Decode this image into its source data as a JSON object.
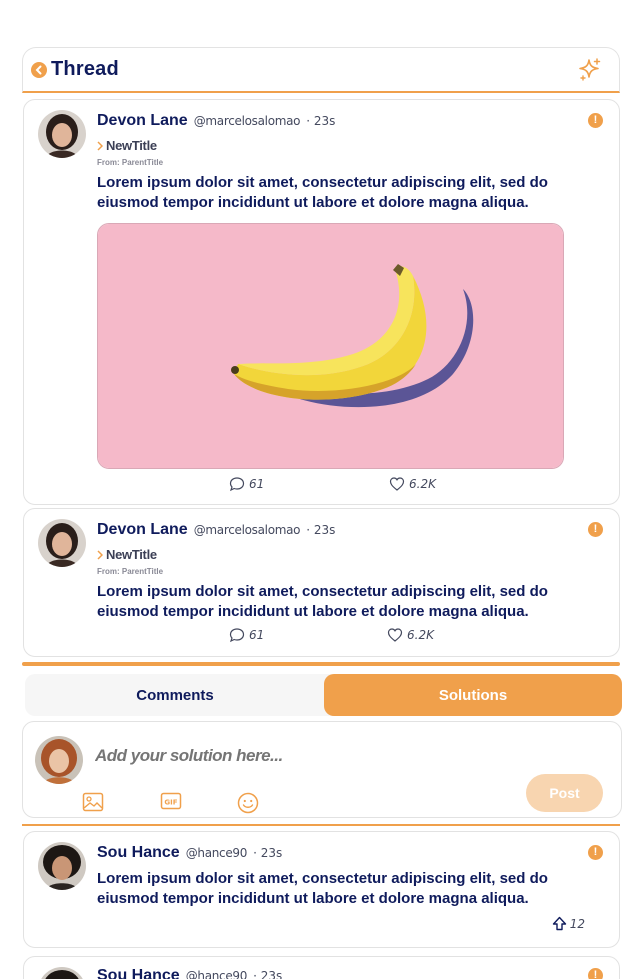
{
  "header": {
    "title": "Thread",
    "back_icon": "chevron-left-icon",
    "action_icon": "sparkle-icon",
    "accent": "#f0a04b"
  },
  "posts": [
    {
      "author": "Devon Lane",
      "handle": "@marcelosalomao",
      "time": "· 23s",
      "new_title": "NewTitle",
      "from": "From: ParentTitle",
      "text": "Lorem ipsum dolor sit amet, consectetur adipiscing elit, sed do eiusmod tempor incididunt ut labore et dolore magna aliqua.",
      "image": "banana-on-pink-background",
      "comments": "61",
      "likes": "6.2K"
    },
    {
      "author": "Devon Lane",
      "handle": "@marcelosalomao",
      "time": "· 23s",
      "new_title": "NewTitle",
      "from": "From: ParentTitle",
      "text": "Lorem ipsum dolor sit amet, consectetur adipiscing elit, sed do eiusmod tempor incididunt ut labore et dolore magna aliqua.",
      "comments": "61",
      "likes": "6.2K"
    }
  ],
  "tabs": [
    {
      "label": "Comments",
      "active": false
    },
    {
      "label": "Solutions",
      "active": true
    }
  ],
  "composer": {
    "placeholder": "Add your solution here...",
    "post_label": "Post",
    "tools": [
      "image-icon",
      "gif-icon",
      "emoji-icon"
    ]
  },
  "solutions": [
    {
      "author": "Sou Hance",
      "handle": "@hance90",
      "time": "· 23s",
      "text": "Lorem ipsum dolor sit amet, consectetur adipiscing elit, sed do eiusmod tempor incididunt ut labore et dolore magna aliqua.",
      "upvotes": "12"
    },
    {
      "author": "Sou Hance",
      "handle": "@hance90",
      "time": "· 23s"
    }
  ]
}
